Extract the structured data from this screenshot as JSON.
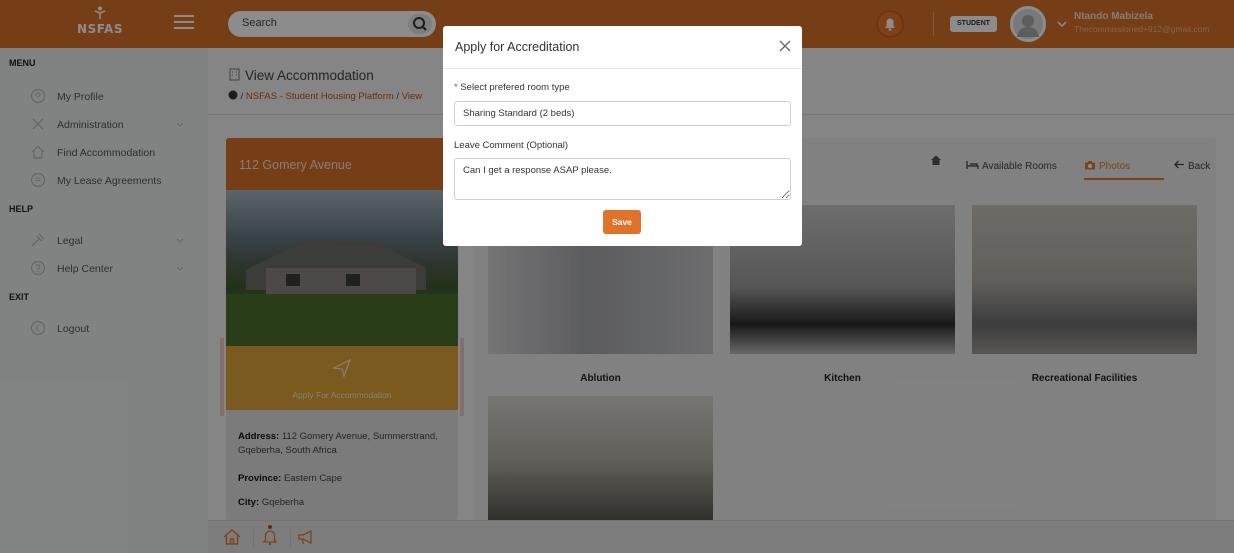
{
  "header": {
    "logo_text": "NSFAS",
    "search_placeholder": "Search",
    "role_badge": "STUDENT",
    "user_name": "Ntando Mabizela",
    "user_email": "Thecommissioned+912@gmail.com",
    "accent_color": "#d8722a"
  },
  "sidebar": {
    "sections": [
      {
        "title": "MENU"
      },
      {
        "title": "HELP"
      },
      {
        "title": "EXIT"
      }
    ],
    "items": [
      {
        "label": "My Profile",
        "icon": "user-icon"
      },
      {
        "label": "Administration",
        "icon": "tools-icon"
      },
      {
        "label": "Find Accommodation",
        "icon": "home-icon"
      },
      {
        "label": "My Lease Agreements",
        "icon": "document-icon"
      },
      {
        "label": "Legal",
        "icon": "gavel-icon"
      },
      {
        "label": "Help Center",
        "icon": "help-icon"
      },
      {
        "label": "Logout",
        "icon": "logout-icon"
      }
    ]
  },
  "page": {
    "title": "View Accommodation",
    "breadcrumb": "NSFAS - Student Housing Platform",
    "breadcrumb_tail": "View"
  },
  "property": {
    "title": "112 Gomery Avenue",
    "apply_label": "Apply For Accommodation",
    "address_label": "Address:",
    "address_value": "112 Gomery Avenue, Summerstrand, Gqeberha, South Africa",
    "province_label": "Province:",
    "province_value": "Eastern Cape",
    "city_label": "City:",
    "city_value": "Gqeberha"
  },
  "gallery": {
    "nav": [
      {
        "label": "Available Rooms",
        "icon": "bed-icon"
      },
      {
        "label": "Photos",
        "icon": "camera-icon",
        "active": true
      },
      {
        "label": "Back",
        "icon": "arrow-left-icon"
      }
    ],
    "photos": [
      {
        "caption": "Ablution"
      },
      {
        "caption": "Kitchen"
      },
      {
        "caption": "Recreational Facilities"
      },
      {
        "caption": ""
      }
    ]
  },
  "modal": {
    "title": "Apply for Accreditation",
    "room_type_label": "Select prefered room type",
    "room_type_value": "Sharing Standard (2 beds)",
    "comment_label": "Leave Comment (Optional)",
    "comment_value": "Can I get a response ASAP please.",
    "save_label": "Save"
  }
}
